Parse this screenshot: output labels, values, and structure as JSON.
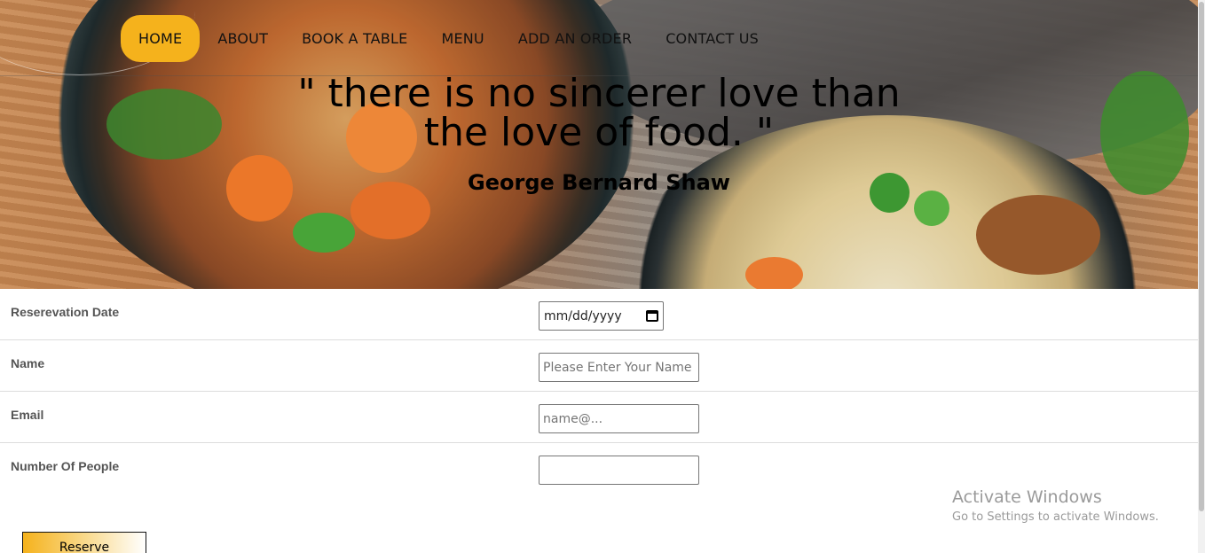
{
  "nav": {
    "items": [
      {
        "label": "HOME",
        "active": true
      },
      {
        "label": "ABOUT"
      },
      {
        "label": "BOOK A TABLE"
      },
      {
        "label": "MENU"
      },
      {
        "label": "ADD AN ORDER"
      },
      {
        "label": "CONTACT US"
      }
    ]
  },
  "hero": {
    "quote": "\" there is no sincerer love than the love of food. \"",
    "author": "George Bernard Shaw"
  },
  "form": {
    "date_label": "Reserevation Date",
    "date_value": "mm/dd/yyyy",
    "name_label": "Name",
    "name_placeholder": "Please Enter Your Name",
    "email_label": "Email",
    "email_placeholder": "name@...",
    "people_label": "Number Of People",
    "people_value": "",
    "submit_label": "Reserve"
  },
  "watermark": {
    "line1": "Activate Windows",
    "line2": "Go to Settings to activate Windows."
  },
  "colors": {
    "accent": "#f5b21c"
  }
}
